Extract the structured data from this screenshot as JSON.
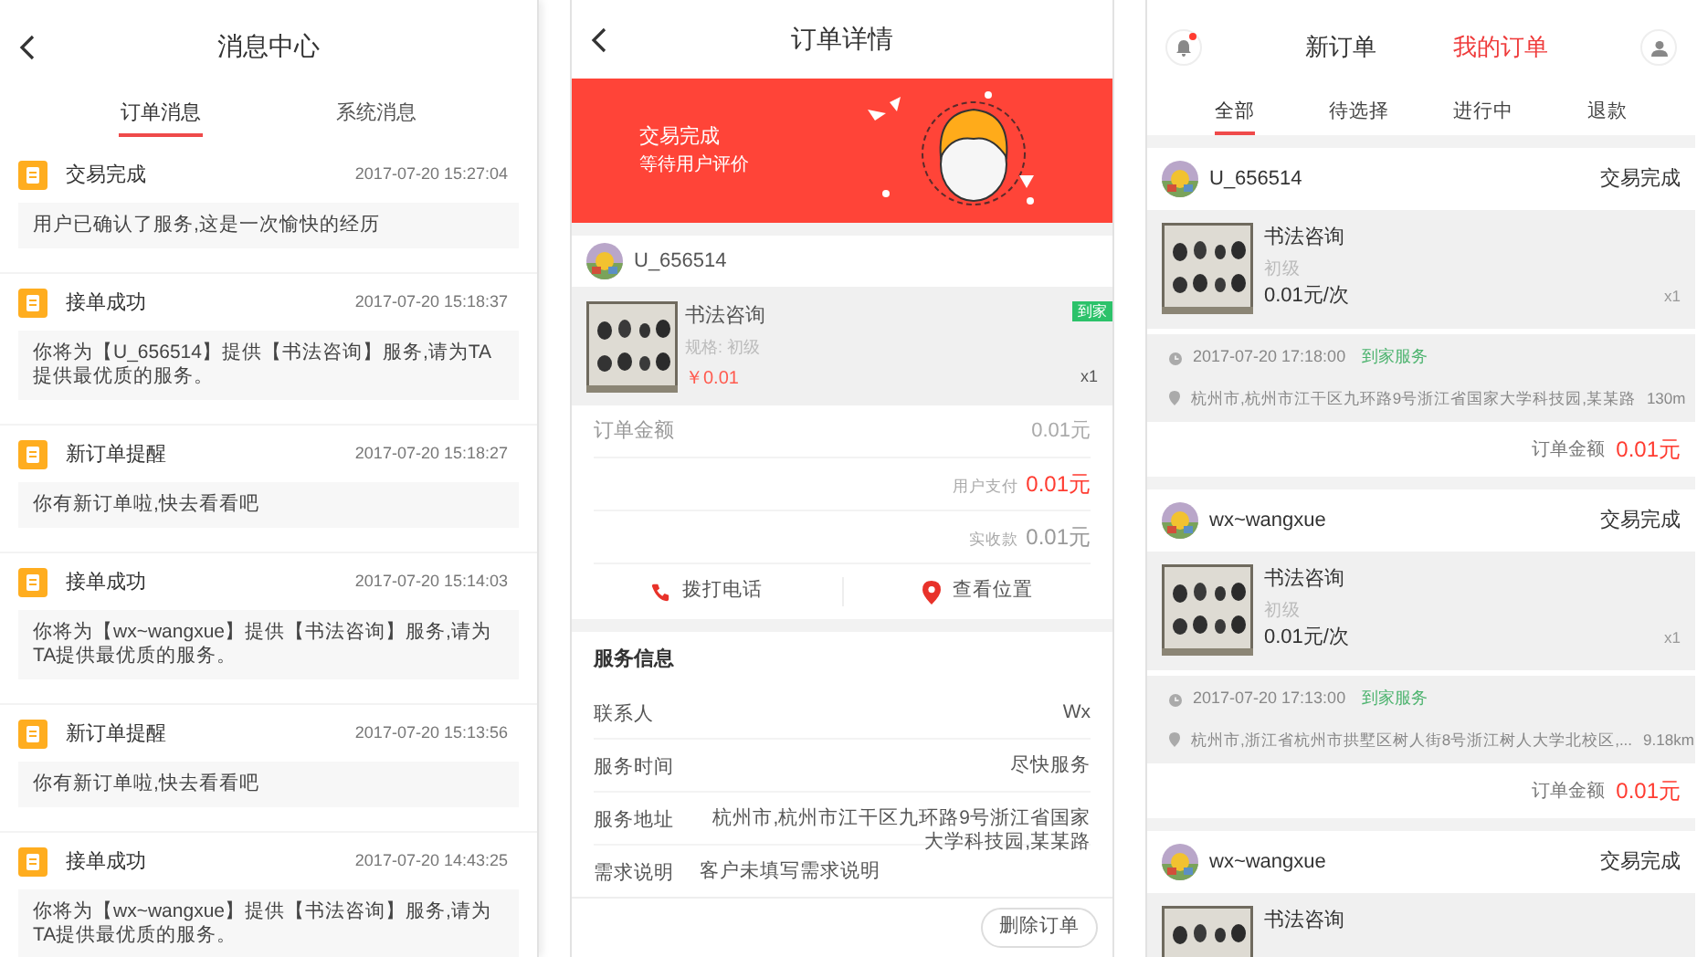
{
  "message_center": {
    "title": "消息中心",
    "tabs": [
      {
        "label": "订单消息",
        "selected": true
      },
      {
        "label": "系统消息",
        "selected": false
      }
    ],
    "messages": [
      {
        "title": "交易完成",
        "time": "2017-07-20 15:27:04",
        "body": "用户已确认了服务,这是一次愉快的经历"
      },
      {
        "title": "接单成功",
        "time": "2017-07-20 15:18:37",
        "body": "你将为【U_656514】提供【书法咨询】服务,请为TA提供最优质的服务。"
      },
      {
        "title": "新订单提醒",
        "time": "2017-07-20 15:18:27",
        "body": "你有新订单啦,快去看看吧"
      },
      {
        "title": "接单成功",
        "time": "2017-07-20 15:14:03",
        "body": "你将为【wx~wangxue】提供【书法咨询】服务,请为TA提供最优质的服务。"
      },
      {
        "title": "新订单提醒",
        "time": "2017-07-20 15:13:56",
        "body": "你有新订单啦,快去看看吧"
      },
      {
        "title": "接单成功",
        "time": "2017-07-20 14:43:25",
        "body": "你将为【wx~wangxue】提供【书法咨询】服务,请为TA提供最优质的服务。"
      }
    ]
  },
  "order_detail": {
    "title": "订单详情",
    "banner": {
      "status": "交易完成",
      "subtitle": "等待用户评价"
    },
    "user": "U_656514",
    "product": {
      "name": "书法咨询",
      "tag": "到家",
      "spec": "规格: 初级",
      "price": "￥0.01",
      "qty": "x1"
    },
    "amounts": [
      {
        "kind": "plain",
        "label": "订单金额",
        "value": "0.01元"
      },
      {
        "kind": "highlight",
        "label": "用户支付",
        "value": "0.01元"
      },
      {
        "kind": "small",
        "label": "实收款",
        "value": "0.01元"
      }
    ],
    "actions": [
      {
        "kind": "phone",
        "label": "拨打电话"
      },
      {
        "kind": "location",
        "label": "查看位置"
      }
    ],
    "service_info": {
      "heading": "服务信息",
      "rows": [
        {
          "label": "联系人",
          "value": "Wx"
        },
        {
          "label": "服务时间",
          "value": "尽快服务"
        },
        {
          "label": "服务地址",
          "value": "杭州市,杭州市江干区九环路9号浙江省国家大学科技园,某某路"
        },
        {
          "label": "需求说明",
          "value": "客户未填写需求说明"
        }
      ]
    },
    "delete_button": "删除订单"
  },
  "my_orders": {
    "unread": true,
    "top_tabs": [
      {
        "label": "新订单",
        "selected": false
      },
      {
        "label": "我的订单",
        "selected": true
      }
    ],
    "sub_tabs": [
      {
        "label": "全部",
        "selected": true
      },
      {
        "label": "待选择",
        "selected": false
      },
      {
        "label": "进行中",
        "selected": false
      },
      {
        "label": "退款",
        "selected": false
      }
    ],
    "orders": [
      {
        "user": "U_656514",
        "status": "交易完成",
        "product": {
          "name": "书法咨询",
          "level": "初级",
          "price": "0.01元/次",
          "qty": "x1"
        },
        "time": "2017-07-20 17:18:00",
        "service_type": "到家服务",
        "address": "杭州市,杭州市江干区九环路9号浙江省国家大学科技园,某某路",
        "distance": "130m",
        "total_label": "订单金额",
        "total": "0.01元"
      },
      {
        "user": "wx~wangxue",
        "status": "交易完成",
        "product": {
          "name": "书法咨询",
          "level": "初级",
          "price": "0.01元/次",
          "qty": "x1"
        },
        "time": "2017-07-20 17:13:00",
        "service_type": "到家服务",
        "address": "杭州市,浙江省杭州市拱墅区树人街8号浙江树人大学北校区,...",
        "distance": "9.18km",
        "total_label": "订单金额",
        "total": "0.01元"
      },
      {
        "user": "wx~wangxue",
        "status": "交易完成",
        "product": {
          "name": "书法咨询"
        }
      }
    ]
  }
}
